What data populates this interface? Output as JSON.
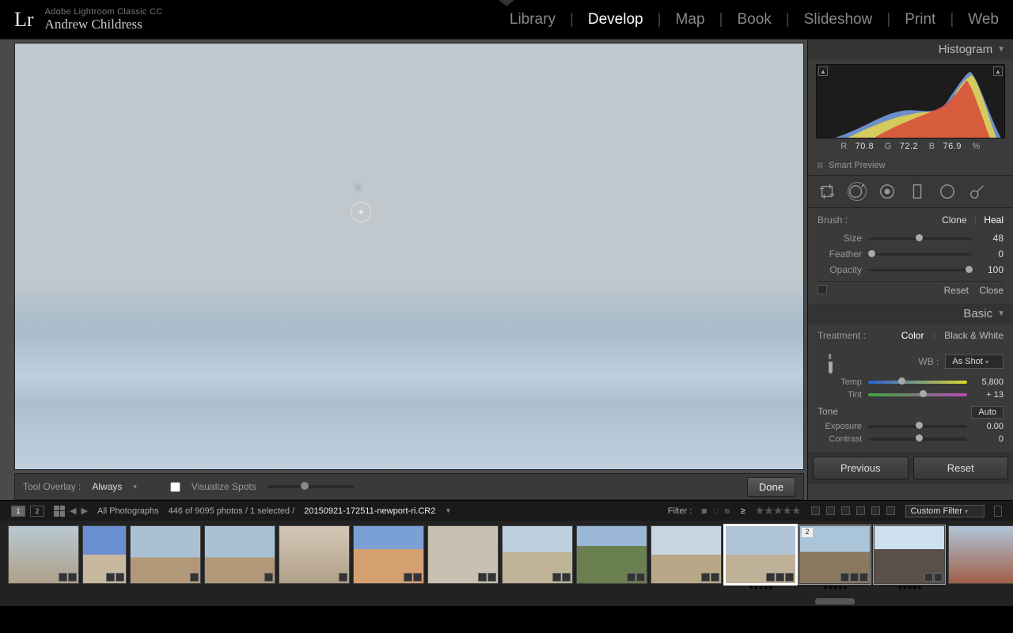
{
  "app": {
    "logo": "Lr",
    "title": "Adobe Lightroom Classic CC",
    "user": "Andrew Childress"
  },
  "modules": [
    "Library",
    "Develop",
    "Map",
    "Book",
    "Slideshow",
    "Print",
    "Web"
  ],
  "active_module": "Develop",
  "toolbar": {
    "overlay_label": "Tool Overlay :",
    "overlay_value": "Always",
    "visualize": "Visualize Spots",
    "done": "Done"
  },
  "buttons": {
    "previous": "Previous",
    "reset": "Reset"
  },
  "histogram": {
    "title": "Histogram",
    "r_label": "R",
    "r": "70.8",
    "g_label": "G",
    "g": "72.2",
    "b_label": "B",
    "b": "76.9",
    "pct": "%",
    "smart": "Smart Preview"
  },
  "brush": {
    "label": "Brush :",
    "clone": "Clone",
    "heal": "Heal",
    "size_l": "Size",
    "size_v": "48",
    "feather_l": "Feather",
    "feather_v": "0",
    "opacity_l": "Opacity",
    "opacity_v": "100",
    "reset": "Reset",
    "close": "Close"
  },
  "basic": {
    "title": "Basic",
    "treat_l": "Treatment :",
    "color": "Color",
    "bw": "Black & White",
    "wb_l": "WB :",
    "wb_v": "As Shot",
    "temp_l": "Temp",
    "temp_v": "5,800",
    "tint_l": "Tint",
    "tint_v": "+ 13",
    "tone_l": "Tone",
    "auto": "Auto",
    "exposure_l": "Exposure",
    "exposure_v": "0.00",
    "contrast_l": "Contrast",
    "contrast_v": "0"
  },
  "filter": {
    "all": "All Photographs",
    "count": "446 of 9095 photos / 1 selected /",
    "file": "20150921-172511-newport-ri.CR2",
    "filter_l": "Filter :",
    "gte": "≥",
    "custom": "Custom Filter",
    "box1": "1",
    "box2": "2"
  },
  "thumbs": {
    "stack_badge": "2"
  }
}
